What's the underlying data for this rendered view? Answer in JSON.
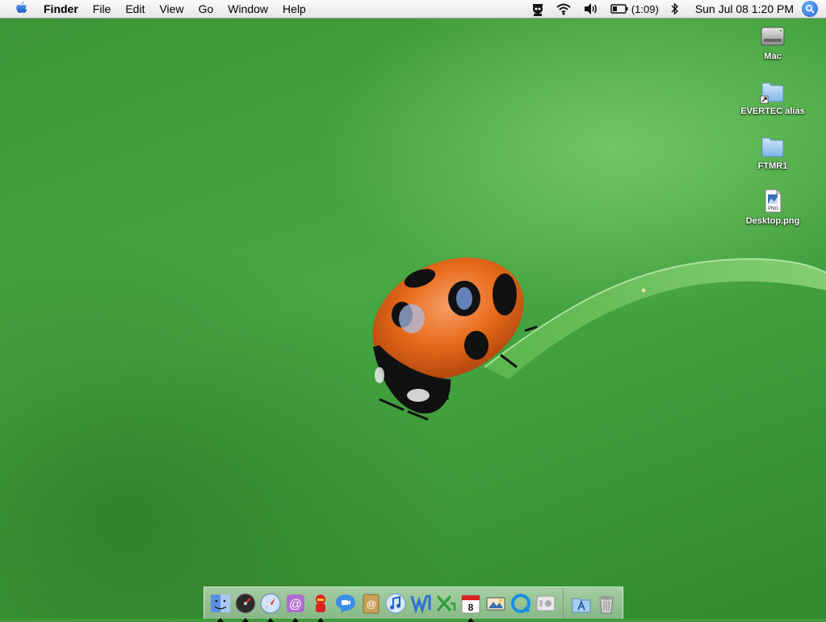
{
  "menubar": {
    "apple_icon": "apple-icon",
    "app_name": "Finder",
    "menus": [
      "File",
      "Edit",
      "View",
      "Go",
      "Window",
      "Help"
    ],
    "extras": {
      "status_icon": "spy-icon",
      "wifi_icon": "wifi-icon",
      "volume_icon": "volume-icon",
      "battery_icon": "battery-icon",
      "battery_time": "(1:09)",
      "bluetooth_icon": "bluetooth-icon"
    },
    "clock": "Sun Jul 08  1:20 PM",
    "spotlight_icon": "spotlight-icon"
  },
  "desktop_icons": [
    {
      "label": "Mac",
      "icon": "hard-drive-icon"
    },
    {
      "label": "EVERTEC alias",
      "icon": "folder-alias-icon"
    },
    {
      "label": "FTMR1",
      "icon": "folder-icon"
    },
    {
      "label": "Desktop.png",
      "icon": "png-file-icon",
      "badge": "PNG"
    }
  ],
  "dock": {
    "apps": [
      {
        "name": "Finder",
        "icon": "finder-icon",
        "running": true
      },
      {
        "name": "Dashboard",
        "icon": "dashboard-icon",
        "running": true
      },
      {
        "name": "Safari",
        "icon": "safari-icon",
        "running": true
      },
      {
        "name": "Mail",
        "icon": "mail-icon",
        "running": true
      },
      {
        "name": "iChat Agent",
        "icon": "chat-agent-icon",
        "running": true
      },
      {
        "name": "iChat",
        "icon": "ichat-icon",
        "running": false
      },
      {
        "name": "Address Book",
        "icon": "address-book-icon",
        "running": false
      },
      {
        "name": "iTunes",
        "icon": "itunes-icon",
        "running": false
      },
      {
        "name": "Word",
        "icon": "word-icon",
        "running": false
      },
      {
        "name": "Excel",
        "icon": "excel-icon",
        "running": false
      },
      {
        "name": "iCal",
        "icon": "ical-icon",
        "running": true
      },
      {
        "name": "iPhoto",
        "icon": "iphoto-icon",
        "running": false
      },
      {
        "name": "QuickTime",
        "icon": "quicktime-icon",
        "running": false
      },
      {
        "name": "System Preferences",
        "icon": "system-preferences-icon",
        "running": false
      }
    ],
    "ical_day": "8",
    "stacks": [
      {
        "name": "Applications",
        "icon": "applications-folder-icon"
      },
      {
        "name": "Trash",
        "icon": "trash-icon"
      }
    ]
  },
  "colors": {
    "desktop_green": "#3f9a3a",
    "ladybug_orange": "#e86a1a",
    "menubar_bg": "#f0f0f0",
    "spotlight_blue": "#1f64d8"
  }
}
